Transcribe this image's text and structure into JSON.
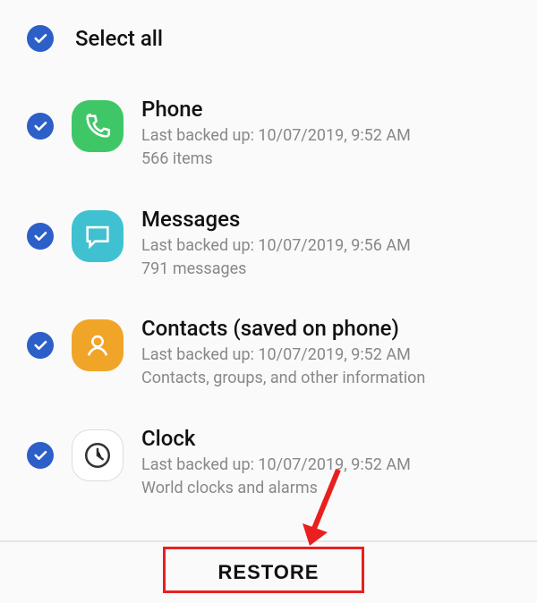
{
  "selectAll": {
    "label": "Select all",
    "checked": true
  },
  "items": [
    {
      "title": "Phone",
      "backup": "Last backed up: 10/07/2019, 9:52 AM",
      "detail": "566 items",
      "icon": "phone",
      "checked": true
    },
    {
      "title": "Messages",
      "backup": "Last backed up: 10/07/2019, 9:56 AM",
      "detail": "791 messages",
      "icon": "messages",
      "checked": true
    },
    {
      "title": "Contacts (saved on phone)",
      "backup": "Last backed up: 10/07/2019, 9:52 AM",
      "detail": "Contacts, groups, and other information",
      "icon": "contacts",
      "checked": true
    },
    {
      "title": "Clock",
      "backup": "Last backed up: 10/07/2019, 9:52 AM",
      "detail": "World clocks and alarms",
      "icon": "clock",
      "checked": true
    }
  ],
  "footer": {
    "restore": "RESTORE"
  },
  "annotation": {
    "arrow_color": "#e82020",
    "box_color": "#e82020"
  }
}
